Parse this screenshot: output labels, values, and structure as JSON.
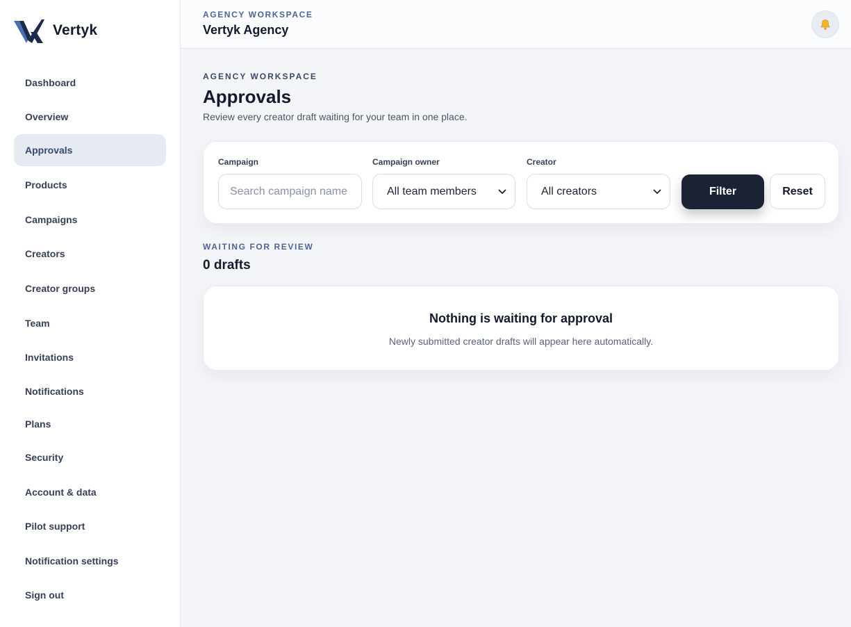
{
  "brand": {
    "name": "Vertyk",
    "logo_icon": "vertyk-logo-icon"
  },
  "sidebar": {
    "items": [
      {
        "label": "Dashboard",
        "active": false
      },
      {
        "label": "Overview",
        "active": false
      },
      {
        "label": "Approvals",
        "active": true
      },
      {
        "label": "Products",
        "active": false
      },
      {
        "label": "Campaigns",
        "active": false
      },
      {
        "label": "Creators",
        "active": false
      },
      {
        "label": "Creator groups",
        "active": false
      },
      {
        "label": "Team",
        "active": false
      },
      {
        "label": "Invitations",
        "active": false
      },
      {
        "label": "Notifications",
        "active": false
      },
      {
        "label": "Plans",
        "active": false
      },
      {
        "label": "Security",
        "active": false
      },
      {
        "label": "Account & data",
        "active": false
      },
      {
        "label": "Pilot support",
        "active": false
      },
      {
        "label": "Notification settings",
        "active": false
      },
      {
        "label": "Sign out",
        "active": false
      }
    ]
  },
  "header": {
    "eyebrow": "AGENCY WORKSPACE",
    "title": "Vertyk Agency",
    "bell_icon": "bell-icon"
  },
  "page": {
    "eyebrow": "AGENCY WORKSPACE",
    "title": "Approvals",
    "subtitle": "Review every creator draft waiting for your team in one place."
  },
  "filters": {
    "campaign": {
      "label": "Campaign",
      "placeholder": "Search campaign name",
      "value": ""
    },
    "owner": {
      "label": "Campaign owner",
      "value": "All team members"
    },
    "creator": {
      "label": "Creator",
      "value": "All creators"
    },
    "filter_label": "Filter",
    "reset_label": "Reset"
  },
  "review": {
    "eyebrow": "WAITING FOR REVIEW",
    "count": "0 drafts",
    "empty_title": "Nothing is waiting for approval",
    "empty_subtitle": "Newly submitted creator drafts will appear here automatically."
  },
  "colors": {
    "accent_dark": "#1b2233",
    "eyebrow_blue": "#4d6592",
    "active_nav_bg": "#e6eaf3",
    "bell_yellow": "#f2b52a"
  }
}
